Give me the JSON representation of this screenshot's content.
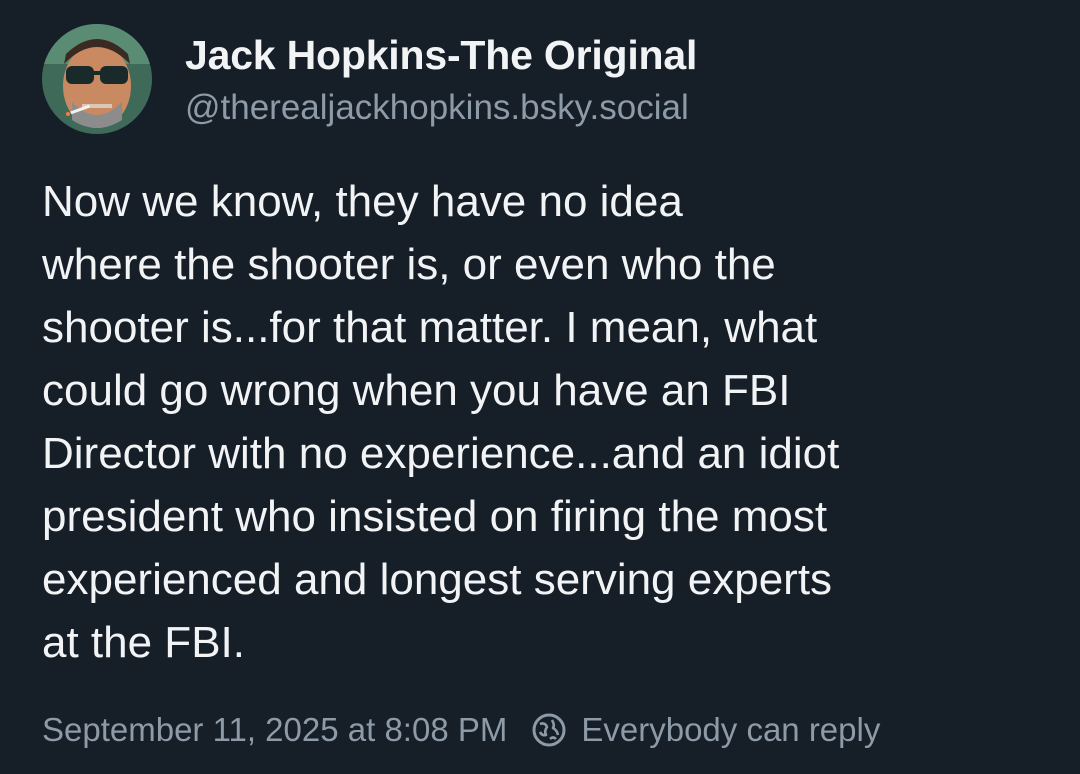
{
  "author": {
    "display_name": "Jack Hopkins-The Original",
    "handle": "@therealjackhopkins.bsky.social",
    "avatar_icon": "user-avatar-photo"
  },
  "post": {
    "text_lines": [
      "Now we know, they have no idea",
      "where the shooter is, or even who the",
      "shooter is...for that matter. I mean, what",
      "could go wrong when you have an FBI",
      "Director with no experience...and an idiot",
      "president who insisted on firing the most",
      "experienced and longest serving experts",
      "at the FBI."
    ]
  },
  "meta": {
    "timestamp": "September 11, 2025 at 8:08 PM",
    "reply_setting_label": "Everybody can reply",
    "reply_setting_icon": "globe-icon"
  },
  "colors": {
    "background": "#161e27",
    "text_primary": "#f1f3f5",
    "text_secondary": "#8d9aa8"
  }
}
